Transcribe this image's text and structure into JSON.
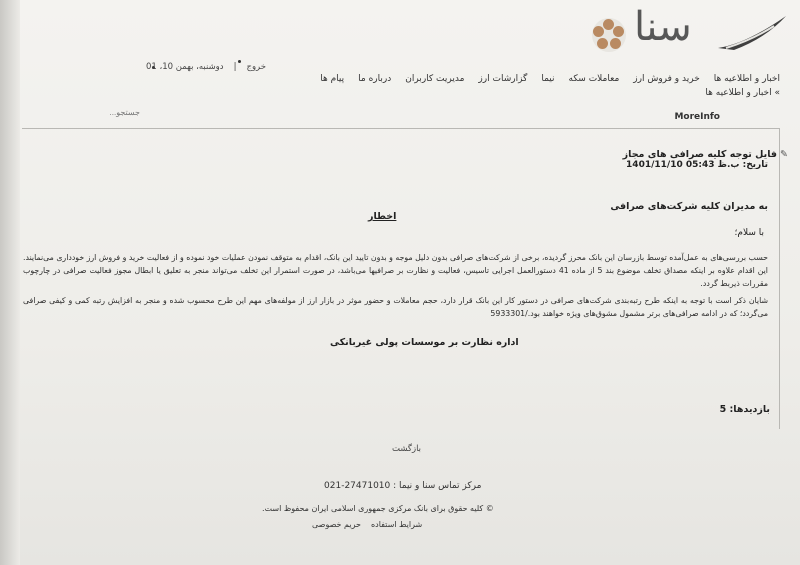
{
  "header": {
    "logo_text": "سنا",
    "date_text": "دوشنبه، بهمن 10، 01",
    "logout_label": "خروج",
    "nav": [
      "اخبار و اطلاعیه ها",
      "خرید و فروش ارز",
      "معاملات سکه",
      "نیما",
      "گزارشات ارز",
      "مدیریت کاربران",
      "درباره ما",
      "پیام ها"
    ]
  },
  "breadcrumb": "» اخبار و اطلاعیه ها",
  "search": {
    "placeholder": "جستجو..."
  },
  "moreinfo_label": "MoreInfo",
  "article": {
    "title": "فایل توجه کلیه صرافی های مجاز",
    "date": "تاریخ: ب.ظ 05:43 1401/11/10",
    "recipient": "به مدیران کلیه شرکت‌های صرافی",
    "warning": "اخطار",
    "salute": "با سلام؛",
    "para1": "حسب بررسی‌های به عمل‌آمده توسط بازرسان این بانک محرز گردیده، برخی از شرکت‌های صرافی بدون دلیل موجه و بدون تایید این بانک، اقدام به متوقف نمودن عملیات خود نموده و از فعالیت خرید و فروش ارز خودداری می‌نمایند. این اقدام علاوه بر اینکه مصداق تخلف موضوع بند 5 از ماده 41 دستورالعمل اجرایی تاسیس، فعالیت و نظارت بر صرافیها می‌باشد، در صورت استمرار این تخلف می‌تواند منجر به تعلیق یا ابطال مجوز فعالیت صرافی در چارچوب مقررات ذیربط گردد.",
    "para2": "شایان ذکر است با توجه به اینکه طرح رتبه‌بندی شرکت‌های صرافی در دستور کار این بانک قرار دارد، حجم معاملات و حضور موثر در بازار ارز از مولفه‌های مهم این طرح محسوب شده و منجر به افزایش رتبه کمی و کیفی صرافی می‌گردد؛ که در ادامه صرافی‌های برتر مشمول مشوق‌های ویژه خواهند بود./5933301",
    "signature": "اداره نظارت بر موسسات پولی غیربانکی",
    "visits": "بازدیدها: 5"
  },
  "back_label": "بازگشت",
  "footer": {
    "contact": "مرکز تماس سنا و نیما : 27471010-021",
    "copyright": "© کلیه حقوق برای بانک مرکزی جمهوری اسلامی ایران محفوظ است.",
    "terms": "شرایط استفاده",
    "privacy": "حریم خصوصی"
  }
}
